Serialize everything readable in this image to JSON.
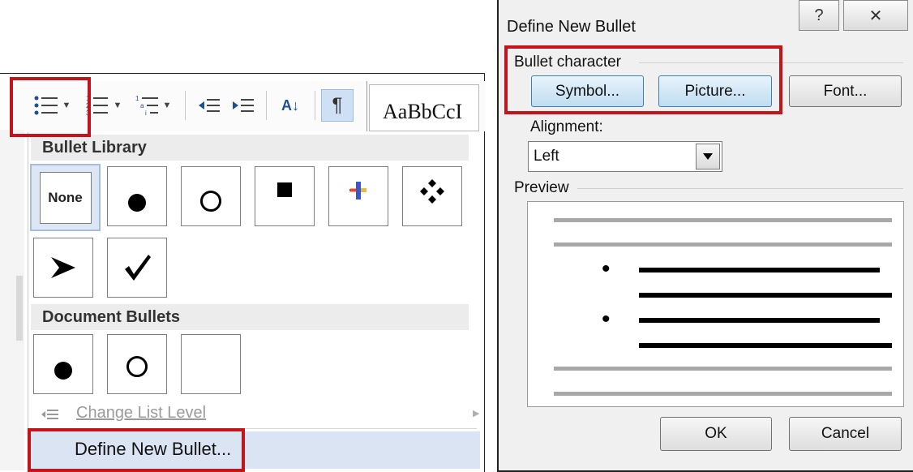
{
  "ribbon": {
    "bullets_button": "bullets",
    "numbering_button": "numbering",
    "multilevel_button": "multilevel",
    "decrease_indent": "decrease-indent",
    "increase_indent": "increase-indent",
    "sort_label": "A↓",
    "pilcrow": "¶",
    "styles_preview": "AaBbCcI"
  },
  "menu": {
    "bullet_library_header": "Bullet Library",
    "none_label": "None",
    "document_bullets_header": "Document Bullets",
    "change_list_level": "Change List Level",
    "define_new_bullet": "Define New Bullet..."
  },
  "dialog": {
    "title": "Define New Bullet",
    "help_glyph": "?",
    "close_glyph": "✕",
    "bullet_character_label": "Bullet character",
    "symbol_button": "Symbol...",
    "picture_button": "Picture...",
    "font_button": "Font...",
    "alignment_label": "Alignment:",
    "alignment_value": "Left",
    "preview_label": "Preview",
    "preview_bullets": [
      "•",
      "•"
    ],
    "ok_button": "OK",
    "cancel_button": "Cancel"
  },
  "colors": {
    "highlight_box": "#c3131b",
    "selected_tile_bg": "#dce6f4",
    "define_row_bg": "#dbe4f2"
  }
}
